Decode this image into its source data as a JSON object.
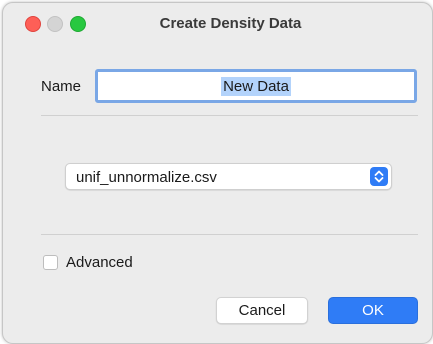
{
  "window": {
    "title": "Create Density Data"
  },
  "name": {
    "label": "Name",
    "value": "New Data"
  },
  "file_select": {
    "selected": "unif_unnormalize.csv"
  },
  "advanced": {
    "label": "Advanced",
    "checked": false
  },
  "buttons": {
    "cancel_label": "Cancel",
    "ok_label": "OK"
  },
  "colors": {
    "accent": "#2f7cf6",
    "close": "#fe5f57",
    "zoom": "#28c840",
    "focus_ring": "#7aa7e6",
    "selection": "#b3d3fb"
  }
}
